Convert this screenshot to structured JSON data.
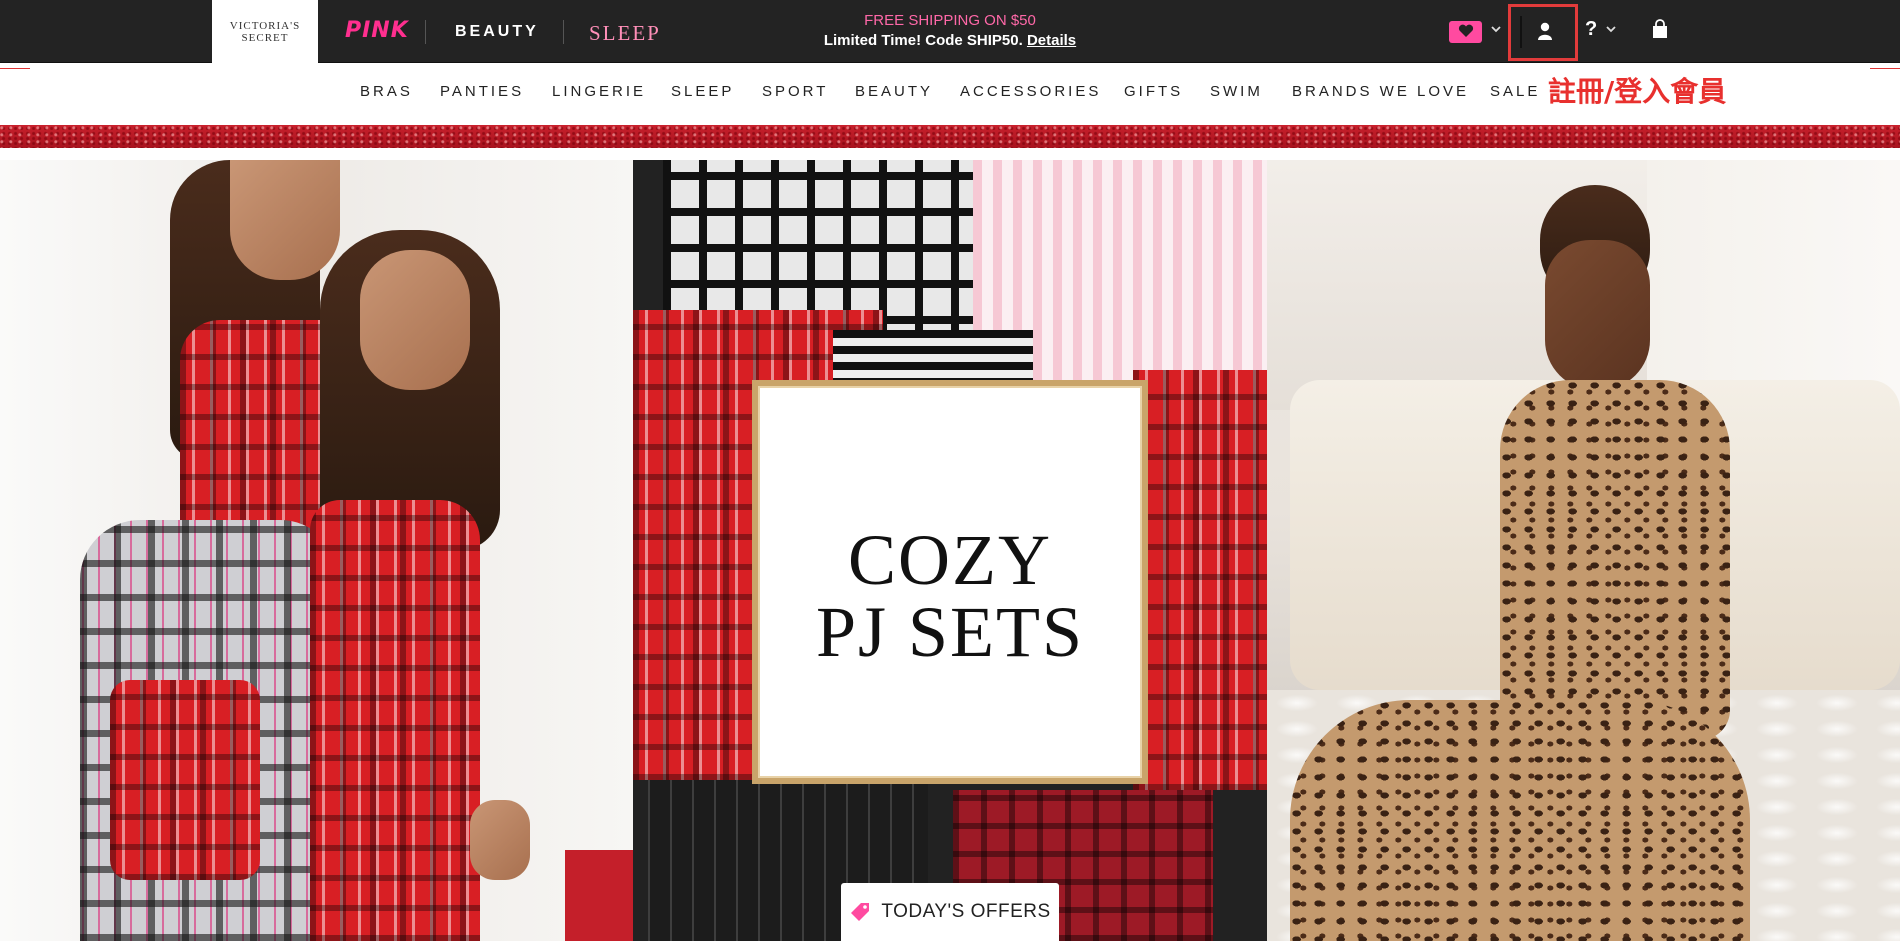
{
  "topbar": {
    "logo_line1": "VICTORIA'S",
    "logo_line2": "SECRET",
    "brand_pink": "PINK",
    "brand_beauty": "BEAUTY",
    "brand_sleep": "SLEEP",
    "promo_line1": "FREE SHIPPING ON $50",
    "promo_line2": "Limited Time! Code SHIP50.",
    "promo_link": "Details",
    "help_label": "?"
  },
  "nav": {
    "items": [
      "BRAS",
      "PANTIES",
      "LINGERIE",
      "SLEEP",
      "SPORT",
      "BEAUTY",
      "ACCESSORIES",
      "GIFTS",
      "SWIM",
      "BRANDS WE LOVE",
      "SALE"
    ]
  },
  "annotation": {
    "text": "註冊/登入會員"
  },
  "hero": {
    "title_line1": "COZY",
    "title_line2": "PJ SETS",
    "offers_label": "TODAY'S OFFERS"
  },
  "colors": {
    "topbar_bg": "#232323",
    "pink_accent": "#ff2f8f",
    "annotation_red": "#e8302e",
    "glitter_red": "#c8202c"
  }
}
